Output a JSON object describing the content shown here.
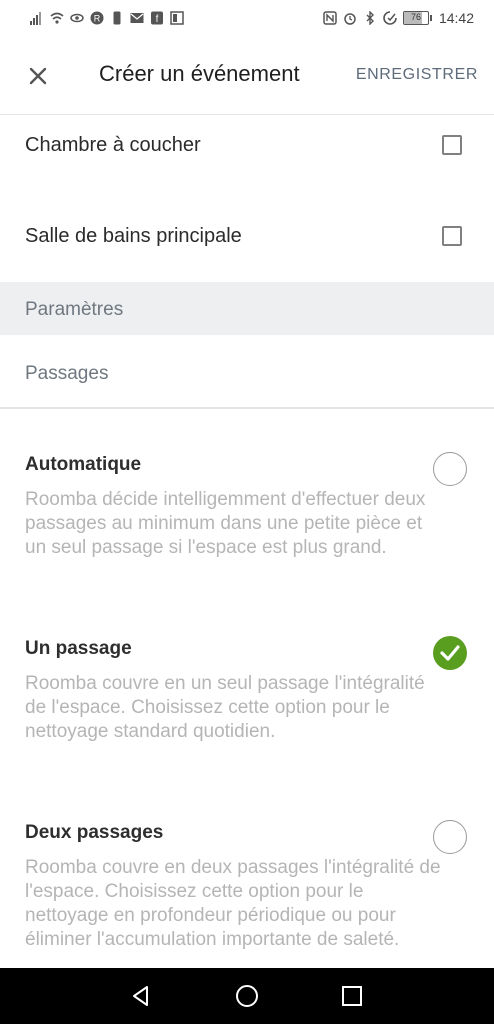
{
  "status_bar": {
    "time": "14:42",
    "battery_level": "76",
    "left_icons": [
      "signal-icon",
      "wifi-icon",
      "eye-icon",
      "r-app-icon",
      "phone-icon",
      "mail-icon",
      "f-app-icon",
      "image-icon"
    ],
    "right_icons": [
      "nfc-icon",
      "alarm-icon",
      "bluetooth-icon",
      "data-saver-icon"
    ]
  },
  "header": {
    "title": "Créer un événement",
    "save_label": "ENREGISTRER"
  },
  "rooms": [
    {
      "label": "Chambre à coucher",
      "checked": false
    },
    {
      "label": "Salle de bains principale",
      "checked": false
    }
  ],
  "section": {
    "title": "Paramètres",
    "subtitle": "Passages"
  },
  "options": [
    {
      "title": "Automatique",
      "description": "Roomba décide intelligemment d'effectuer deux passages au minimum dans une petite pièce et un seul passage si l'espace est plus grand.",
      "selected": false
    },
    {
      "title": "Un passage",
      "description": "Roomba couvre en un seul passage l'intégralité de l'espace. Choisissez cette option pour le nettoyage standard quotidien.",
      "selected": true
    },
    {
      "title": "Deux passages",
      "description": "Roomba couvre en deux passages l'intégralité de l'espace. Choisissez cette option pour le nettoyage en profondeur périodique ou pour éliminer l'accumulation importante de saleté.",
      "selected": false
    }
  ],
  "colors": {
    "accent_green": "#5a9e1f",
    "section_bg": "#eeeff1",
    "muted_text": "#b5b5b5"
  },
  "navbar": {
    "icons": [
      "back-icon",
      "home-icon",
      "recents-icon"
    ]
  }
}
